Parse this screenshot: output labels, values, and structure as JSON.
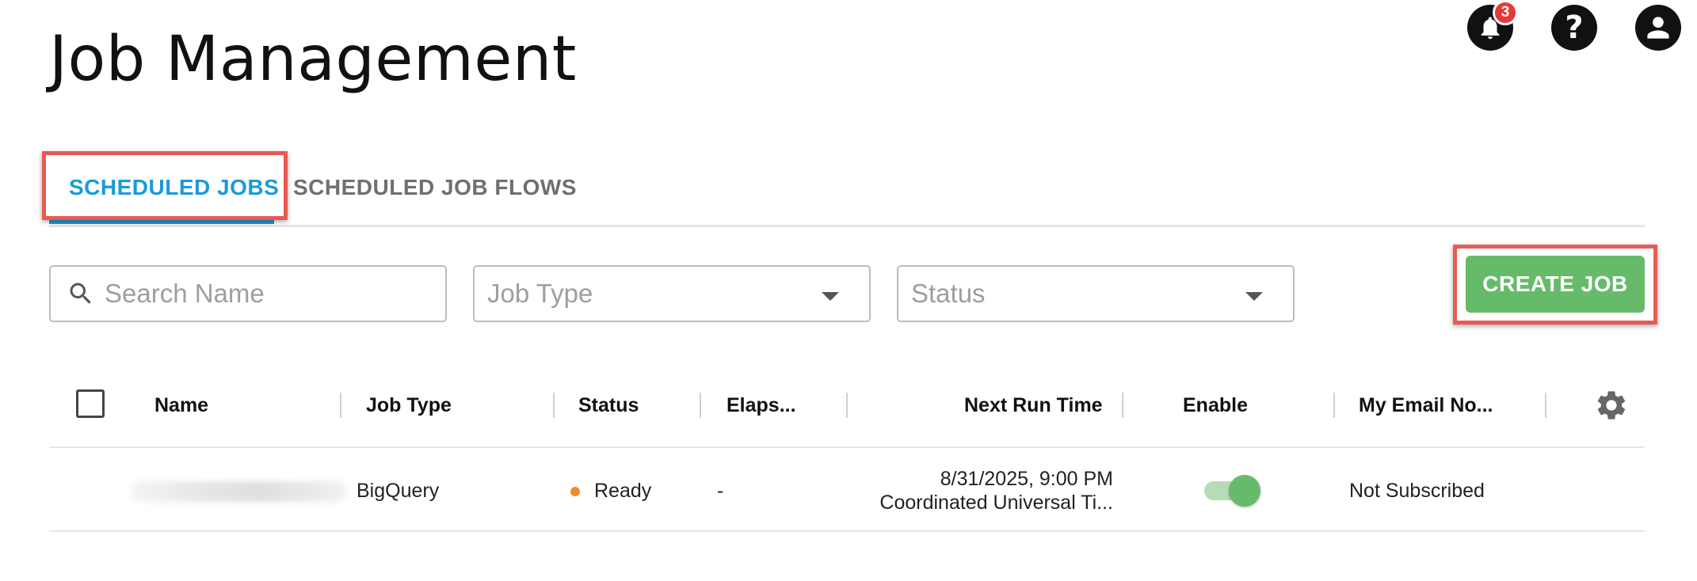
{
  "page": {
    "title": "Job Management"
  },
  "header_icons": {
    "notifications": {
      "icon": "bell-icon",
      "badge_count": "3"
    },
    "help": {
      "icon": "help-icon",
      "glyph": "?"
    },
    "account": {
      "icon": "user-icon"
    }
  },
  "tabs": [
    {
      "label": "SCHEDULED JOBS",
      "active": true
    },
    {
      "label": "SCHEDULED JOB FLOWS",
      "active": false
    }
  ],
  "filters": {
    "search_placeholder": "Search Name",
    "job_type_placeholder": "Job Type",
    "status_placeholder": "Status"
  },
  "actions": {
    "create_job_label": "CREATE JOB"
  },
  "table": {
    "columns": [
      "Name",
      "Job Type",
      "Status",
      "Elaps...",
      "Next Run Time",
      "Enable",
      "My Email No..."
    ],
    "rows": [
      {
        "name": "",
        "job_type": "BigQuery",
        "status": "Ready",
        "elapsed": "-",
        "next_run_date": "8/31/2025, 9:00 PM",
        "next_run_tz": "Coordinated Universal Ti...",
        "enabled": true,
        "email_notification": "Not Subscribed"
      }
    ]
  },
  "colors": {
    "accent_blue": "#1a9bd7",
    "create_green": "#66bb6a",
    "highlight_red": "#e85a53",
    "status_ready": "#f28c28",
    "badge_red": "#e53935"
  }
}
